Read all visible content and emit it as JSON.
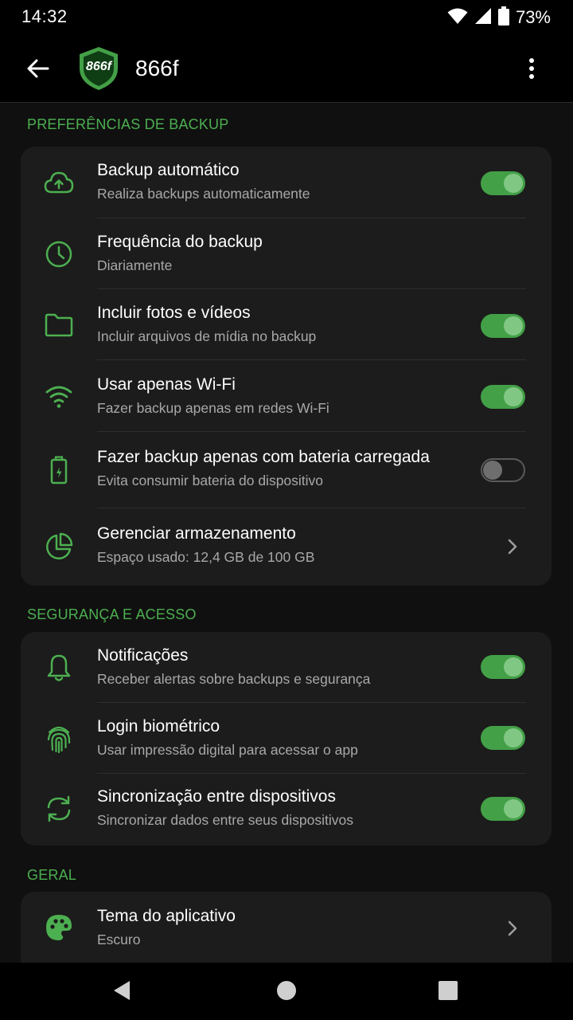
{
  "status_bar": {
    "time": "14:32",
    "battery_percent": "73%",
    "icons": [
      "wifi-icon",
      "signal-icon",
      "battery-icon"
    ]
  },
  "app_bar": {
    "logo_text": "866f",
    "title": "866f",
    "icons": [
      "back-arrow-icon",
      "more-vert-icon"
    ]
  },
  "colors": {
    "accent": "#4caf50",
    "toggle_on": "#43a047",
    "card_bg": "#1c1c1c",
    "page_bg": "#101010"
  },
  "sections": [
    {
      "header": "PREFERÊNCIAS DE BACKUP",
      "items": [
        {
          "icon": "cloud-upload-icon",
          "title": "Backup automático",
          "subtitle": "Realiza backups automaticamente",
          "control": "toggle",
          "enabled": true
        },
        {
          "icon": "clock-icon",
          "title": "Frequência do backup",
          "subtitle": "Diariamente",
          "control": "none"
        },
        {
          "icon": "folder-icon",
          "title": "Incluir fotos e vídeos",
          "subtitle": "Incluir arquivos de mídia no backup",
          "control": "toggle",
          "enabled": true
        },
        {
          "icon": "wifi-icon",
          "title": "Usar apenas Wi-Fi",
          "subtitle": "Fazer backup apenas em redes Wi-Fi",
          "control": "toggle",
          "enabled": true
        },
        {
          "icon": "battery-charging-icon",
          "title": "Fazer backup apenas com bateria carregada",
          "subtitle": "Evita consumir bateria do dispositivo",
          "control": "toggle",
          "enabled": false
        },
        {
          "icon": "pie-chart-icon",
          "title": "Gerenciar armazenamento",
          "subtitle": "Espaço usado: 12,4 GB de 100 GB",
          "control": "chevron"
        }
      ]
    },
    {
      "header": "SEGURANÇA E ACESSO",
      "items": [
        {
          "icon": "bell-icon",
          "title": "Notificações",
          "subtitle": "Receber alertas sobre backups e segurança",
          "control": "toggle",
          "enabled": true
        },
        {
          "icon": "fingerprint-icon",
          "title": "Login biométrico",
          "subtitle": "Usar impressão digital para acessar o app",
          "control": "toggle",
          "enabled": true
        },
        {
          "icon": "sync-icon",
          "title": "Sincronização entre dispositivos",
          "subtitle": "Sincronizar dados entre seus dispositivos",
          "control": "toggle",
          "enabled": true
        }
      ]
    },
    {
      "header": "GERAL",
      "items": [
        {
          "icon": "palette-icon",
          "title": "Tema do aplicativo",
          "subtitle": "Escuro",
          "control": "chevron"
        }
      ]
    }
  ],
  "nav_bar": {
    "icons": [
      "back-triangle-icon",
      "home-circle-icon",
      "recents-square-icon"
    ]
  }
}
